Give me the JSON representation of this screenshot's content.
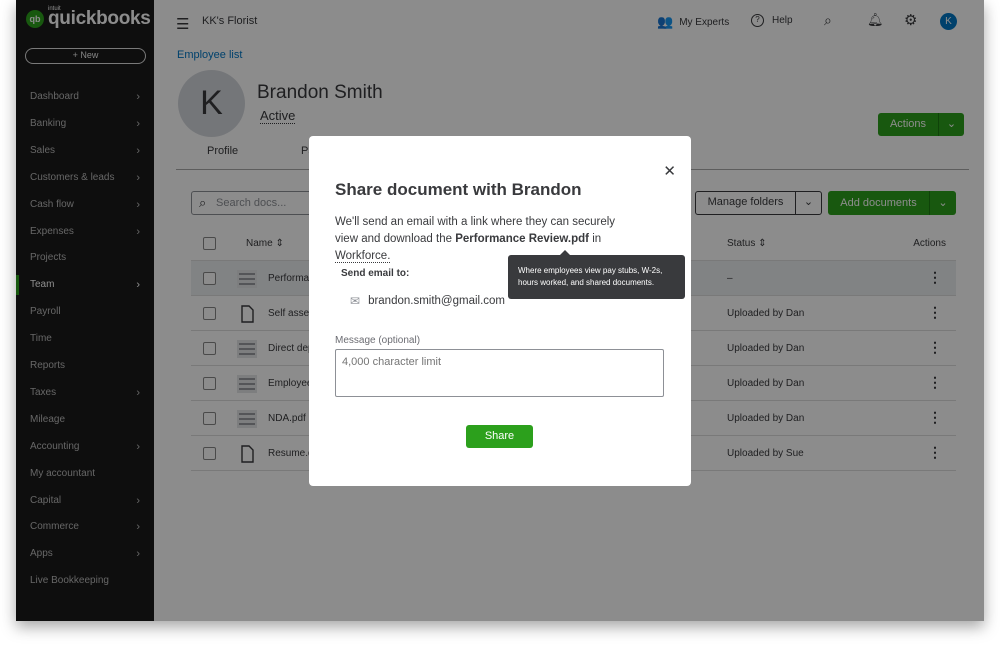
{
  "sidebar": {
    "logo_brand": "intuit",
    "logo": "quickbooks",
    "new_label": "New",
    "items": [
      {
        "label": "Dashboard",
        "chevron": true
      },
      {
        "label": "Banking",
        "chevron": true
      },
      {
        "label": "Sales",
        "chevron": true
      },
      {
        "label": "Customers & leads",
        "chevron": true
      },
      {
        "label": "Cash flow",
        "chevron": true
      },
      {
        "label": "Expenses",
        "chevron": true
      },
      {
        "label": "Projects",
        "chevron": false
      },
      {
        "label": "Team",
        "chevron": true,
        "active": true
      },
      {
        "label": "Payroll",
        "chevron": false
      },
      {
        "label": "Time",
        "chevron": false
      },
      {
        "label": "Reports",
        "chevron": false
      },
      {
        "label": "Taxes",
        "chevron": true
      },
      {
        "label": "Mileage",
        "chevron": false
      },
      {
        "label": "Accounting",
        "chevron": true
      },
      {
        "label": "My accountant",
        "chevron": false
      },
      {
        "label": "Capital",
        "chevron": true
      },
      {
        "label": "Commerce",
        "chevron": true
      },
      {
        "label": "Apps",
        "chevron": true
      },
      {
        "label": "Live Bookkeeping",
        "chevron": false
      }
    ]
  },
  "header": {
    "company": "KK's Florist",
    "my_experts": "My Experts",
    "help": "Help",
    "avatar_initial": "K"
  },
  "employee": {
    "breadcrumb": "Employee list",
    "initial": "K",
    "name": "Brandon Smith",
    "status": "Active",
    "actions_label": "Actions",
    "tabs": [
      "Profile",
      "Pa"
    ]
  },
  "docs": {
    "search_placeholder": "Search docs...",
    "manage_folders": "Manage folders",
    "add_documents": "Add documents",
    "columns": {
      "name": "Name",
      "status": "Status",
      "actions": "Actions"
    },
    "rows": [
      {
        "name": "Performance Review.pdf",
        "status": "–",
        "icon": "image-doc"
      },
      {
        "name": "Self assessment",
        "status": "Uploaded by Dan",
        "icon": "file"
      },
      {
        "name": "Direct deposit",
        "status": "Uploaded by Dan",
        "icon": "image-doc"
      },
      {
        "name": "Employee",
        "status": "Uploaded by Dan",
        "icon": "image-doc"
      },
      {
        "name": "NDA.pdf",
        "status": "Uploaded by Dan",
        "icon": "image-doc"
      },
      {
        "name": "Resume.docx",
        "status": "Uploaded by Sue",
        "icon": "file"
      }
    ]
  },
  "modal": {
    "title": "Share document with Brandon",
    "body_pre": "We'll send an email with a link where they can securely view and download the ",
    "file": "Performance Review.pdf",
    "body_mid": " in ",
    "link": "Workforce.",
    "tooltip": "Where employees view pay stubs, W-2s, hours worked, and shared documents.",
    "send_label": "Send email to:",
    "email": "brandon.smith@gmail.com",
    "message_label": "Message (optional)",
    "message_placeholder": "4,000 character limit",
    "share": "Share"
  },
  "colors": {
    "brand_green": "#2ca01c",
    "sidebar": "#1b1b1b",
    "avatar_blue": "#0077c5",
    "tooltip": "#393a3d"
  }
}
